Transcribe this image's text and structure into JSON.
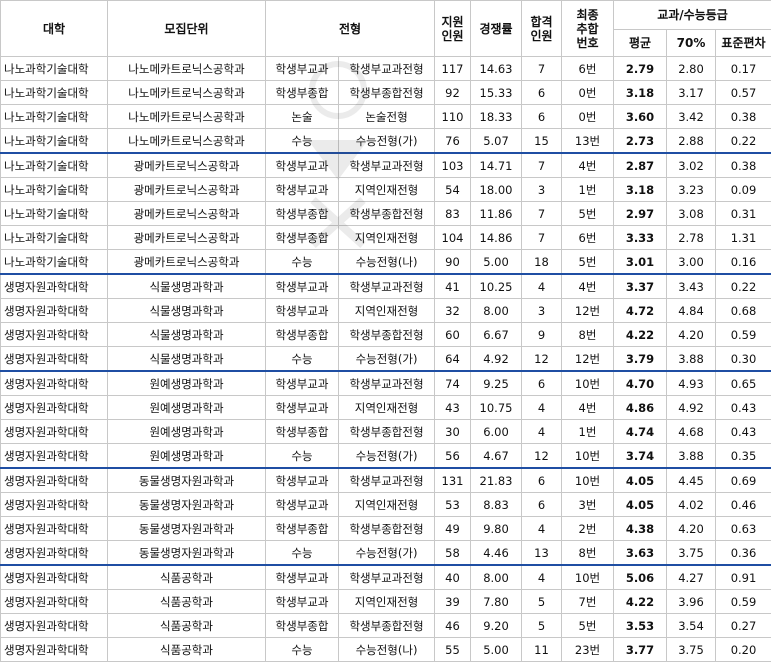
{
  "headers": {
    "univ": "대학",
    "unit": "모집단위",
    "type": "전형",
    "quota": "지원\n인원",
    "rate": "경쟁률",
    "pass": "합격\n인원",
    "final": "최종\n추합\n번호",
    "grade_group": "교과/수능등급",
    "avg": "평균",
    "p70": "70%",
    "std": "표준편차"
  },
  "rows": [
    [
      "나노과학기술대학",
      "나노메카트로닉스공학과",
      "학생부교과",
      "학생부교과전형",
      "117",
      "14.63",
      "7",
      "6번",
      "2.79",
      "2.80",
      "0.17"
    ],
    [
      "나노과학기술대학",
      "나노메카트로닉스공학과",
      "학생부종합",
      "학생부종합전형",
      "92",
      "15.33",
      "6",
      "0번",
      "3.18",
      "3.17",
      "0.57"
    ],
    [
      "나노과학기술대학",
      "나노메카트로닉스공학과",
      "논술",
      "논술전형",
      "110",
      "18.33",
      "6",
      "0번",
      "3.60",
      "3.42",
      "0.38"
    ],
    [
      "나노과학기술대학",
      "나노메카트로닉스공학과",
      "수능",
      "수능전형(가)",
      "76",
      "5.07",
      "15",
      "13번",
      "2.73",
      "2.88",
      "0.22"
    ],
    [
      "나노과학기술대학",
      "광메카트로닉스공학과",
      "학생부교과",
      "학생부교과전형",
      "103",
      "14.71",
      "7",
      "4번",
      "2.87",
      "3.02",
      "0.38"
    ],
    [
      "나노과학기술대학",
      "광메카트로닉스공학과",
      "학생부교과",
      "지역인재전형",
      "54",
      "18.00",
      "3",
      "1번",
      "3.18",
      "3.23",
      "0.09"
    ],
    [
      "나노과학기술대학",
      "광메카트로닉스공학과",
      "학생부종합",
      "학생부종합전형",
      "83",
      "11.86",
      "7",
      "5번",
      "2.97",
      "3.08",
      "0.31"
    ],
    [
      "나노과학기술대학",
      "광메카트로닉스공학과",
      "학생부종합",
      "지역인재전형",
      "104",
      "14.86",
      "7",
      "6번",
      "3.33",
      "2.78",
      "1.31"
    ],
    [
      "나노과학기술대학",
      "광메카트로닉스공학과",
      "수능",
      "수능전형(나)",
      "90",
      "5.00",
      "18",
      "5번",
      "3.01",
      "3.00",
      "0.16"
    ],
    [
      "생명자원과학대학",
      "식물생명과학과",
      "학생부교과",
      "학생부교과전형",
      "41",
      "10.25",
      "4",
      "4번",
      "3.37",
      "3.43",
      "0.22"
    ],
    [
      "생명자원과학대학",
      "식물생명과학과",
      "학생부교과",
      "지역인재전형",
      "32",
      "8.00",
      "3",
      "12번",
      "4.72",
      "4.84",
      "0.68"
    ],
    [
      "생명자원과학대학",
      "식물생명과학과",
      "학생부종합",
      "학생부종합전형",
      "60",
      "6.67",
      "9",
      "8번",
      "4.22",
      "4.20",
      "0.59"
    ],
    [
      "생명자원과학대학",
      "식물생명과학과",
      "수능",
      "수능전형(가)",
      "64",
      "4.92",
      "12",
      "12번",
      "3.79",
      "3.88",
      "0.30"
    ],
    [
      "생명자원과학대학",
      "원예생명과학과",
      "학생부교과",
      "학생부교과전형",
      "74",
      "9.25",
      "6",
      "10번",
      "4.70",
      "4.93",
      "0.65"
    ],
    [
      "생명자원과학대학",
      "원예생명과학과",
      "학생부교과",
      "지역인재전형",
      "43",
      "10.75",
      "4",
      "4번",
      "4.86",
      "4.92",
      "0.43"
    ],
    [
      "생명자원과학대학",
      "원예생명과학과",
      "학생부종합",
      "학생부종합전형",
      "30",
      "6.00",
      "4",
      "1번",
      "4.74",
      "4.68",
      "0.43"
    ],
    [
      "생명자원과학대학",
      "원예생명과학과",
      "수능",
      "수능전형(가)",
      "56",
      "4.67",
      "12",
      "10번",
      "3.74",
      "3.88",
      "0.35"
    ],
    [
      "생명자원과학대학",
      "동물생명자원과학과",
      "학생부교과",
      "학생부교과전형",
      "131",
      "21.83",
      "6",
      "10번",
      "4.05",
      "4.45",
      "0.69"
    ],
    [
      "생명자원과학대학",
      "동물생명자원과학과",
      "학생부교과",
      "지역인재전형",
      "53",
      "8.83",
      "6",
      "3번",
      "4.05",
      "4.02",
      "0.46"
    ],
    [
      "생명자원과학대학",
      "동물생명자원과학과",
      "학생부종합",
      "학생부종합전형",
      "49",
      "9.80",
      "4",
      "2번",
      "4.38",
      "4.20",
      "0.63"
    ],
    [
      "생명자원과학대학",
      "동물생명자원과학과",
      "수능",
      "수능전형(가)",
      "58",
      "4.46",
      "13",
      "8번",
      "3.63",
      "3.75",
      "0.36"
    ],
    [
      "생명자원과학대학",
      "식품공학과",
      "학생부교과",
      "학생부교과전형",
      "40",
      "8.00",
      "4",
      "10번",
      "5.06",
      "4.27",
      "0.91"
    ],
    [
      "생명자원과학대학",
      "식품공학과",
      "학생부교과",
      "지역인재전형",
      "39",
      "7.80",
      "5",
      "7번",
      "4.22",
      "3.96",
      "0.59"
    ],
    [
      "생명자원과학대학",
      "식품공학과",
      "학생부종합",
      "학생부종합전형",
      "46",
      "9.20",
      "5",
      "5번",
      "3.53",
      "3.54",
      "0.27"
    ],
    [
      "생명자원과학대학",
      "식품공학과",
      "수능",
      "수능전형(나)",
      "55",
      "5.00",
      "11",
      "23번",
      "3.77",
      "3.75",
      "0.20"
    ]
  ],
  "group_starts": [
    4,
    9,
    13,
    17,
    21
  ]
}
